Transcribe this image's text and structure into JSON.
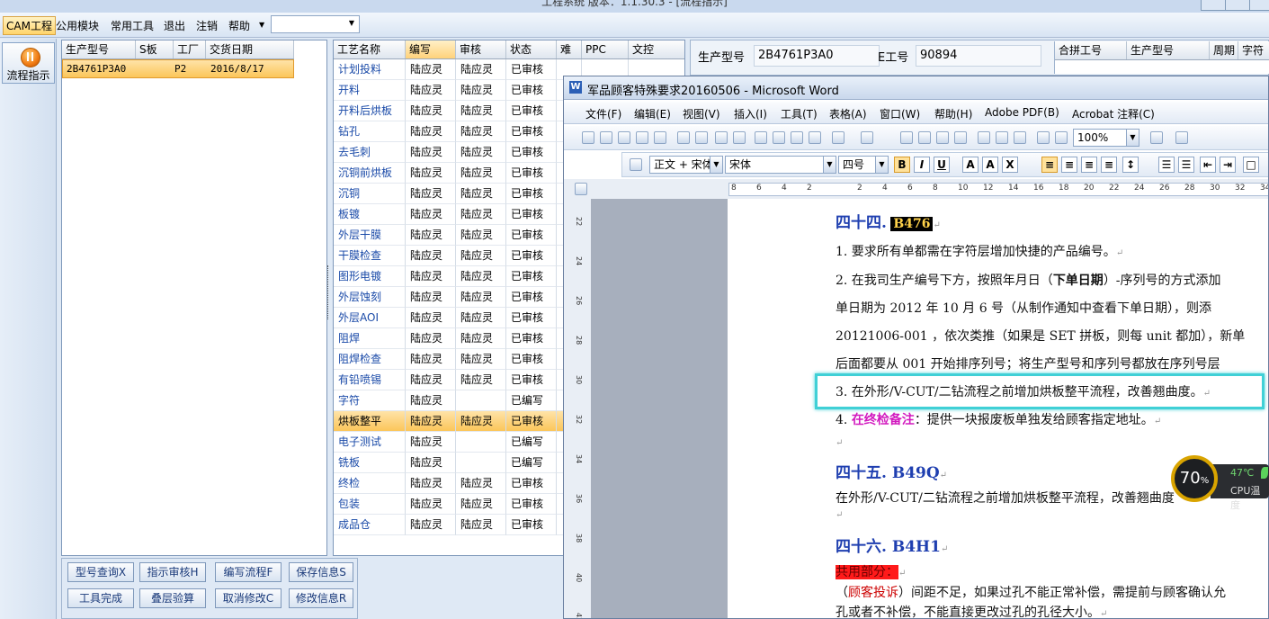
{
  "app": {
    "title": "工程系统   版本：1.1.30.3 - [流程指示]",
    "menu": [
      "CAM工程",
      "公用模块",
      "常用工具",
      "退出",
      "注销",
      "帮助"
    ],
    "combo_value": ""
  },
  "sidebar": {
    "flow_label": "流程指示"
  },
  "order_grid": {
    "headers": [
      "生产型号",
      "S板",
      "工厂",
      "交货日期"
    ],
    "row": {
      "model": "2B4761P3A0",
      "s": "",
      "factory": "P2",
      "date": "2016/8/17"
    }
  },
  "process_grid": {
    "headers": [
      "工艺名称",
      "编写",
      "审核",
      "状态",
      "难",
      "PPC",
      "文控"
    ],
    "rows": [
      {
        "name": "计划投料",
        "edit": "陆应灵",
        "rev": "陆应灵",
        "stat": "已审核"
      },
      {
        "name": "开料",
        "edit": "陆应灵",
        "rev": "陆应灵",
        "stat": "已审核"
      },
      {
        "name": "开料后烘板",
        "edit": "陆应灵",
        "rev": "陆应灵",
        "stat": "已审核"
      },
      {
        "name": "钻孔",
        "edit": "陆应灵",
        "rev": "陆应灵",
        "stat": "已审核"
      },
      {
        "name": "去毛刺",
        "edit": "陆应灵",
        "rev": "陆应灵",
        "stat": "已审核"
      },
      {
        "name": "沉铜前烘板",
        "edit": "陆应灵",
        "rev": "陆应灵",
        "stat": "已审核"
      },
      {
        "name": "沉铜",
        "edit": "陆应灵",
        "rev": "陆应灵",
        "stat": "已审核"
      },
      {
        "name": "板镀",
        "edit": "陆应灵",
        "rev": "陆应灵",
        "stat": "已审核"
      },
      {
        "name": "外层干膜",
        "edit": "陆应灵",
        "rev": "陆应灵",
        "stat": "已审核"
      },
      {
        "name": "干膜检查",
        "edit": "陆应灵",
        "rev": "陆应灵",
        "stat": "已审核"
      },
      {
        "name": "图形电镀",
        "edit": "陆应灵",
        "rev": "陆应灵",
        "stat": "已审核"
      },
      {
        "name": "外层蚀刻",
        "edit": "陆应灵",
        "rev": "陆应灵",
        "stat": "已审核"
      },
      {
        "name": "外层AOI",
        "edit": "陆应灵",
        "rev": "陆应灵",
        "stat": "已审核"
      },
      {
        "name": "阻焊",
        "edit": "陆应灵",
        "rev": "陆应灵",
        "stat": "已审核"
      },
      {
        "name": "阻焊检查",
        "edit": "陆应灵",
        "rev": "陆应灵",
        "stat": "已审核"
      },
      {
        "name": "有铅喷锡",
        "edit": "陆应灵",
        "rev": "陆应灵",
        "stat": "已审核"
      },
      {
        "name": "字符",
        "edit": "陆应灵",
        "rev": "",
        "stat": "已编写"
      },
      {
        "name": "烘板整平",
        "edit": "陆应灵",
        "rev": "陆应灵",
        "stat": "已审核"
      },
      {
        "name": "电子测试",
        "edit": "陆应灵",
        "rev": "",
        "stat": "已编写"
      },
      {
        "name": "铣板",
        "edit": "陆应灵",
        "rev": "",
        "stat": "已编写"
      },
      {
        "name": "终检",
        "edit": "陆应灵",
        "rev": "陆应灵",
        "stat": "已审核"
      },
      {
        "name": "包装",
        "edit": "陆应灵",
        "rev": "陆应灵",
        "stat": "已审核"
      },
      {
        "name": "成品仓",
        "edit": "陆应灵",
        "rev": "陆应灵",
        "stat": "已审核"
      }
    ],
    "selected_index": 17
  },
  "info": {
    "model_label": "生产型号",
    "model_value": "2B4761P3A0",
    "eno_label": "E工号",
    "eno_value": "90894",
    "rgrid_headers": [
      "合拼工号",
      "生产型号",
      "周期",
      "字符"
    ]
  },
  "buttons": [
    "型号查询X",
    "指示审核H",
    "编写流程F",
    "保存信息S",
    "工具完成",
    "叠层验算",
    "取消修改C",
    "修改信息R"
  ],
  "word": {
    "title": "军品顾客特殊要求20160506 - Microsoft Word",
    "menu": [
      "文件(F)",
      "编辑(E)",
      "视图(V)",
      "插入(I)",
      "工具(T)",
      "表格(A)",
      "窗口(W)",
      "帮助(H)",
      "Adobe PDF(B)",
      "Acrobat 注释(C)"
    ],
    "zoom": "100%",
    "style": "正文 + 宋体",
    "font": "宋体",
    "size": "四号",
    "ruler_h": [
      "8",
      "6",
      "4",
      "2",
      "",
      "2",
      "4",
      "6",
      "8",
      "10",
      "12",
      "14",
      "16",
      "18",
      "20",
      "22",
      "24",
      "26",
      "28",
      "30",
      "32",
      "34"
    ],
    "ruler_v": [
      "22",
      "24",
      "26",
      "28",
      "30",
      "32",
      "34",
      "36",
      "38",
      "40",
      "42"
    ],
    "doc": {
      "h44_prefix": "四十四.",
      "h44_code": "B476",
      "p1": "1.  要求所有单都需在字符层增加快捷的产品编号。",
      "p2a": "2.  在我司生产编号下方，按照年月日（",
      "p2b": "下单日期",
      "p2c": "）-序列号的方式添加",
      "p2d": "单日期为  2012 年 10 月 6 号（从制作通知中查看下单日期），则添",
      "p2e": "20121006-001 ，依次类推（如果是 SET 拼板，则每 unit 都加），新单",
      "p2f": "后面都要从 001 开始排序列号；将生产型号和序列号都放在序列号层",
      "p3": "3.  在外形/V-CUT/二钻流程之前增加烘板整平流程，改善翘曲度。",
      "p4a": "4.  ",
      "p4b": "在终检备注",
      "p4c": "：提供一块报废板单独发给顾客指定地址。",
      "h45": "四十五.  B49Q",
      "p5": "在外形/V-CUT/二钻流程之前增加烘板整平流程，改善翘曲度",
      "h46": "四十六.  B4H1",
      "common": "共用部分：",
      "p6a": "（",
      "p6b": "顾客投诉",
      "p6c": "）间距不足，如果过孔不能正常补偿，需提前与顾客确认允",
      "p6d": "孔或者不补偿，不能直接更改过孔的孔径大小。"
    }
  },
  "cpu": {
    "percent": "70",
    "pct_sign": "%",
    "temp": "47℃",
    "label": "CPU温度",
    "ring_color": "#d9a400"
  }
}
